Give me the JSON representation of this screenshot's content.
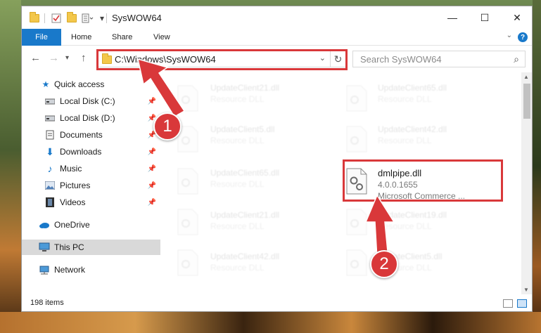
{
  "window": {
    "title": "SysWOW64",
    "minimize": "—",
    "maximize": "☐",
    "close": "✕"
  },
  "ribbon": {
    "tabs": [
      "File",
      "Home",
      "Share",
      "View"
    ],
    "help": "?"
  },
  "address": {
    "path": "C:\\Windows\\SysWOW64"
  },
  "search": {
    "placeholder": "Search SysWOW64"
  },
  "sidebar": {
    "items": [
      {
        "label": "Quick access",
        "icon": "star-icon"
      },
      {
        "label": "Local Disk (C:)",
        "icon": "drive-icon",
        "pinned": true
      },
      {
        "label": "Local Disk (D:)",
        "icon": "drive-icon",
        "pinned": true
      },
      {
        "label": "Documents",
        "icon": "documents-icon",
        "pinned": true
      },
      {
        "label": "Downloads",
        "icon": "download-icon",
        "pinned": true
      },
      {
        "label": "Music",
        "icon": "music-icon",
        "pinned": true
      },
      {
        "label": "Pictures",
        "icon": "pictures-icon",
        "pinned": true
      },
      {
        "label": "Videos",
        "icon": "videos-icon",
        "pinned": true
      },
      {
        "label": "OneDrive",
        "icon": "cloud-icon"
      },
      {
        "label": "This PC",
        "icon": "computer-icon",
        "selected": true
      },
      {
        "label": "Network",
        "icon": "network-icon"
      }
    ]
  },
  "files": {
    "left": [
      {
        "name": "UpdateClient21.dll",
        "type": "Resource DLL"
      },
      {
        "name": "UpdateClient5.dll",
        "type": "Resource DLL"
      },
      {
        "name": "UpdateClient65.dll",
        "type": "Resource DLL"
      },
      {
        "name": "UpdateClient21.dll",
        "type": "Resource DLL"
      },
      {
        "name": "UpdateClient42.dll",
        "type": "Resource DLL"
      }
    ],
    "right": [
      {
        "name": "UpdateClient65.dll",
        "type": "Resource DLL"
      },
      {
        "name": "UpdateClient42.dll",
        "type": "Resource DLL"
      },
      {
        "name": "UpdateClient19.dll",
        "type": "Resource DLL"
      },
      {
        "name": "UpdateClient5.dll",
        "type": "Resource DLL"
      }
    ],
    "highlighted": {
      "name": "dmlpipe.dll",
      "version": "4.0.0.1655",
      "company": "Microsoft Commerce ..."
    }
  },
  "status": {
    "item_count": "198 items"
  },
  "annotations": {
    "badge1": "1",
    "badge2": "2",
    "color": "#d9383a"
  },
  "colors": {
    "accent": "#1979ca"
  }
}
